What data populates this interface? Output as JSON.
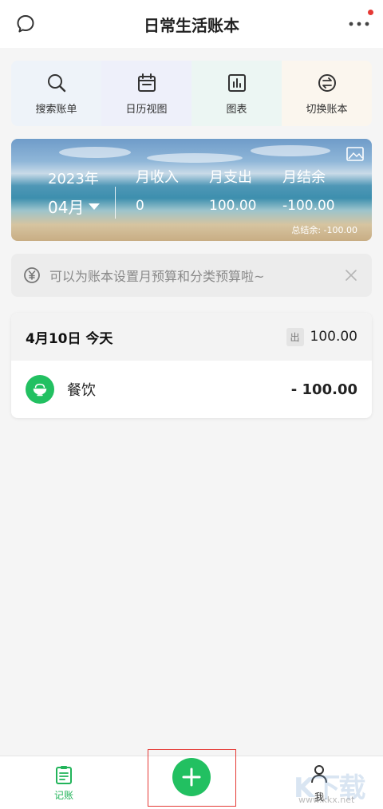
{
  "header": {
    "title": "日常生活账本"
  },
  "quick_actions": [
    {
      "label": "搜索账单",
      "icon": "search-icon",
      "bg": "#eef3f9"
    },
    {
      "label": "日历视图",
      "icon": "calendar-icon",
      "bg": "#eef0fa"
    },
    {
      "label": "图表",
      "icon": "chart-icon",
      "bg": "#ecf6f3"
    },
    {
      "label": "切换账本",
      "icon": "switch-icon",
      "bg": "#fbf6ee"
    }
  ],
  "summary": {
    "year": "2023年",
    "month": "04月",
    "income_label": "月收入",
    "expense_label": "月支出",
    "balance_label": "月结余",
    "income": "0",
    "expense": "100.00",
    "balance": "-100.00",
    "total": "总结余: -100.00"
  },
  "tip": {
    "text": "可以为账本设置月预算和分类预算啦~"
  },
  "day_card": {
    "date": "4月10日 今天",
    "out_badge": "出",
    "out_total": "100.00",
    "entries": [
      {
        "category": "餐饮",
        "icon": "rice-bowl-icon",
        "amount": "- 100.00"
      }
    ]
  },
  "tabbar": {
    "ledger_label": "记账",
    "me_label": "我"
  },
  "watermark": {
    "logo": "K下载",
    "url": "www.kkx.net"
  },
  "colors": {
    "accent": "#22c061",
    "highlight": "#e53935"
  }
}
